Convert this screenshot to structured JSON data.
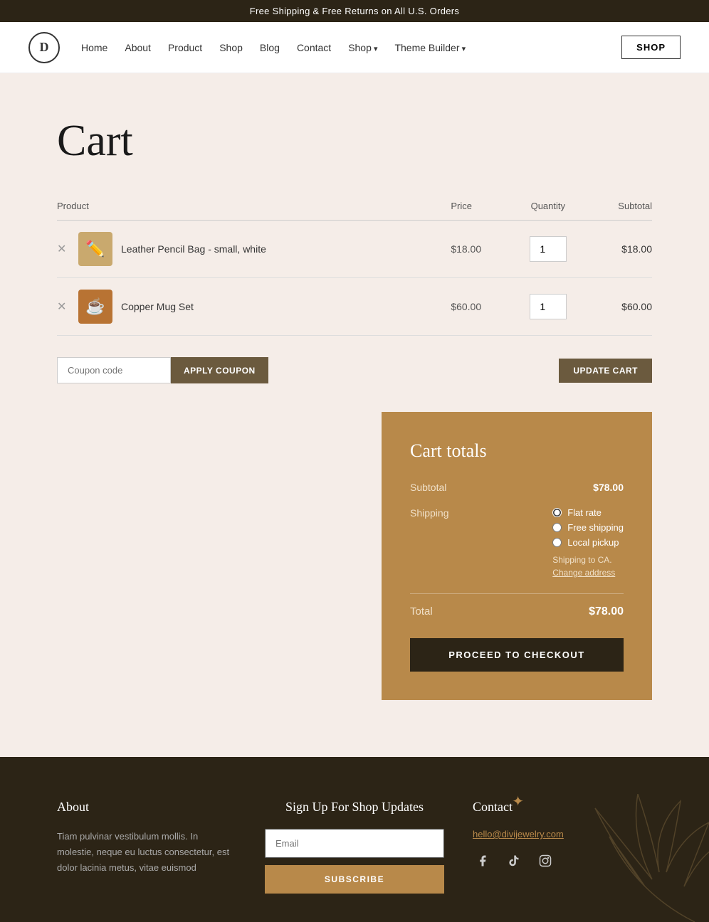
{
  "banner": {
    "text": "Free Shipping & Free Returns on All U.S. Orders"
  },
  "header": {
    "logo": "D",
    "nav": [
      {
        "label": "Home",
        "id": "home"
      },
      {
        "label": "About",
        "id": "about"
      },
      {
        "label": "Product",
        "id": "product"
      },
      {
        "label": "Shop",
        "id": "shop"
      },
      {
        "label": "Blog",
        "id": "blog"
      },
      {
        "label": "Contact",
        "id": "contact"
      },
      {
        "label": "Shop",
        "id": "shop2",
        "hasArrow": true
      },
      {
        "label": "Theme Builder",
        "id": "theme",
        "hasArrow": true
      }
    ],
    "shop_button": "SHOP"
  },
  "page": {
    "title": "Cart"
  },
  "cart": {
    "columns": {
      "product": "Product",
      "price": "Price",
      "quantity": "Quantity",
      "subtotal": "Subtotal"
    },
    "items": [
      {
        "id": "item-1",
        "name": "Leather Pencil Bag - small, white",
        "price": "$18.00",
        "quantity": 1,
        "subtotal": "$18.00",
        "thumb": "pencil"
      },
      {
        "id": "item-2",
        "name": "Copper Mug Set",
        "price": "$60.00",
        "quantity": 1,
        "subtotal": "$60.00",
        "thumb": "mug"
      }
    ],
    "coupon_placeholder": "Coupon code",
    "apply_coupon": "APPLY COUPON",
    "update_cart": "UPDATE CART"
  },
  "cart_totals": {
    "title": "Cart totals",
    "subtotal_label": "Subtotal",
    "subtotal_value": "$78.00",
    "shipping_label": "Shipping",
    "shipping_options": [
      {
        "label": "Flat rate",
        "checked": true
      },
      {
        "label": "Free shipping",
        "checked": false
      },
      {
        "label": "Local pickup",
        "checked": false
      }
    ],
    "shipping_note": "Shipping to CA.",
    "change_address": "Change address",
    "total_label": "Total",
    "total_value": "$78.00",
    "checkout_btn": "PROCEED TO CHECKOUT"
  },
  "footer": {
    "about_title": "About",
    "about_text": "Tiam pulvinar vestibulum mollis. In molestie, neque eu luctus consectetur, est dolor lacinia metus, vitae euismod",
    "signup_title": "Sign Up For Shop Updates",
    "email_placeholder": "Email",
    "subscribe_btn": "SUBSCRIBE",
    "contact_title": "Contact",
    "contact_email": "hello@divijewelry.com",
    "social": [
      {
        "icon": "facebook",
        "symbol": "f"
      },
      {
        "icon": "tiktok",
        "symbol": "♪"
      },
      {
        "icon": "instagram",
        "symbol": "◻"
      }
    ]
  }
}
